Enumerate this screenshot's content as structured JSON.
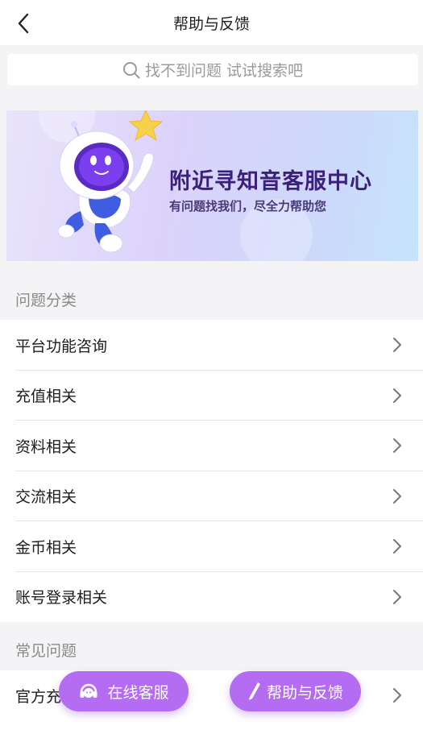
{
  "header": {
    "title": "帮助与反馈",
    "back_icon": "chevron-left-icon"
  },
  "search": {
    "placeholder": "找不到问题 试试搜索吧",
    "icon": "search-icon"
  },
  "banner": {
    "title": "附近寻知音客服中心",
    "subtitle": "有问题找我们，尽全力帮助您"
  },
  "categories": {
    "title": "问题分类",
    "items": [
      {
        "label": "平台功能咨询"
      },
      {
        "label": "充值相关"
      },
      {
        "label": "资料相关"
      },
      {
        "label": "交流相关"
      },
      {
        "label": "金币相关"
      },
      {
        "label": "账号登录相关"
      }
    ]
  },
  "faq": {
    "title": "常见问题",
    "items": [
      {
        "label": "官方充"
      }
    ]
  },
  "floating": {
    "online_service": "在线客服",
    "feedback": "帮助与反馈"
  },
  "colors": {
    "accent": "#b46cf2",
    "banner_title": "#3b1f7a"
  }
}
